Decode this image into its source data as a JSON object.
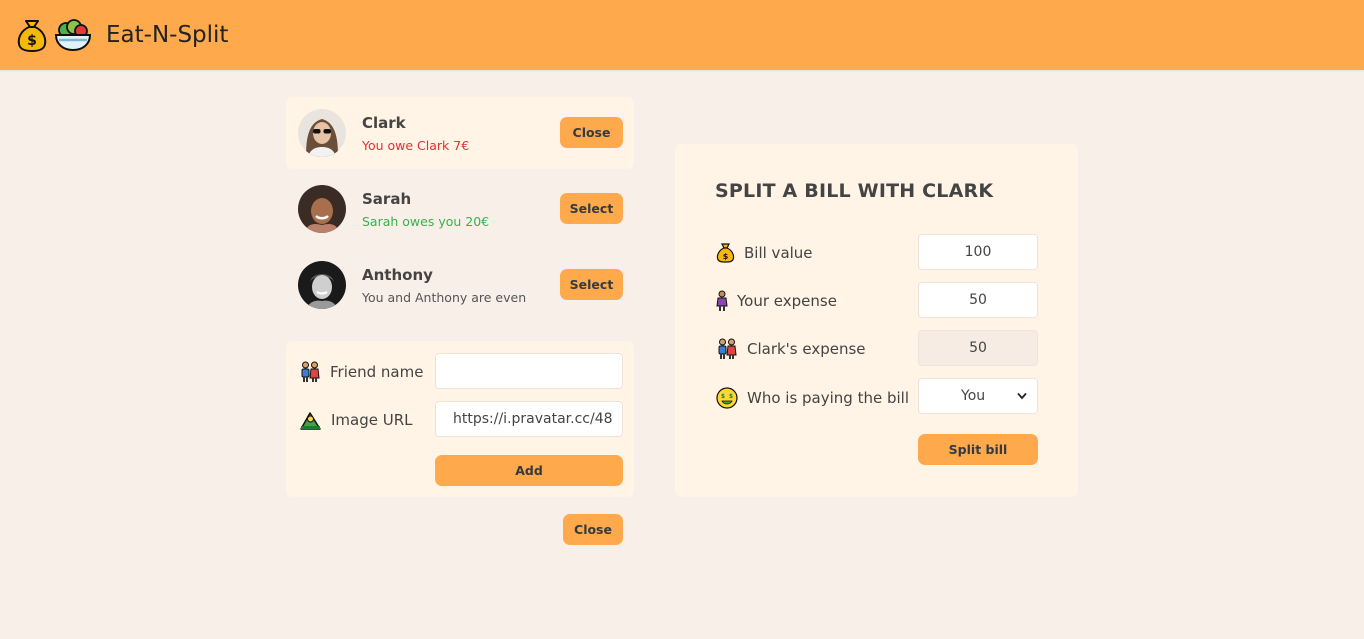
{
  "header": {
    "title": "Eat-N-Split",
    "icons": [
      "money-bag-icon",
      "salad-icon"
    ]
  },
  "friends": [
    {
      "name": "Clark",
      "balance_text": "You owe Clark 7€",
      "status": "owe",
      "button": "Close",
      "selected": true
    },
    {
      "name": "Sarah",
      "balance_text": "Sarah owes you 20€",
      "status": "owed",
      "button": "Select",
      "selected": false
    },
    {
      "name": "Anthony",
      "balance_text": "You and Anthony are even",
      "status": "even",
      "button": "Select",
      "selected": false
    }
  ],
  "add_friend_form": {
    "friend_name_label": "Friend name",
    "friend_name_value": "",
    "image_url_label": "Image URL",
    "image_url_value": "https://i.pravatar.cc/48",
    "add_button": "Add"
  },
  "close_form_button": "Close",
  "split_form": {
    "title": "SPLIT A BILL WITH CLARK",
    "bill_label": "Bill value",
    "bill_value": "100",
    "your_expense_label": "Your expense",
    "your_expense_value": "50",
    "friend_expense_label": "Clark's expense",
    "friend_expense_value": "50",
    "payer_label": "Who is paying the bill",
    "payer_value": "You",
    "submit_button": "Split bill"
  },
  "colors": {
    "accent": "#ffa94d",
    "background": "#f8efe8",
    "panel": "#fff4e6",
    "red": "#e03131",
    "green": "#37b24d"
  }
}
